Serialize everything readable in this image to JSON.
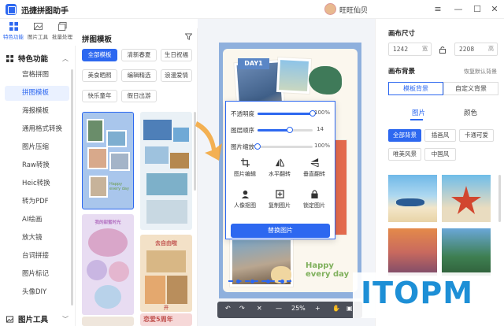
{
  "app": {
    "title": "迅捷拼图助手",
    "user_name": "旺旺仙贝"
  },
  "rail": [
    {
      "label": "特色功能",
      "icon": "grid-icon",
      "active": true
    },
    {
      "label": "图片工具",
      "icon": "image-tool-icon",
      "active": false
    },
    {
      "label": "批量处理",
      "icon": "batch-icon",
      "active": false
    }
  ],
  "nav": {
    "section_features": "特色功能",
    "items": [
      "宫格拼图",
      "拼图模板",
      "海报模板",
      "通用格式转换",
      "图片压缩",
      "Raw转换",
      "Heic转换",
      "转为PDF",
      "AI绘画",
      "放大镜",
      "台词拼接",
      "图片标记",
      "头像DIY"
    ],
    "active_index": 1,
    "section_image_tools": "图片工具"
  },
  "template_panel": {
    "title": "拼图模板",
    "tags": [
      "全部模板",
      "清新春夏",
      "生日祝福",
      "美食晒照",
      "编辑精选",
      "浪漫爱情",
      "快乐童年",
      "假日出游"
    ],
    "active_tag_index": 0,
    "thumb_text": {
      "t3_line1": "我的甜蜜时光",
      "t4_line1": "去自由啦",
      "t4_line2": "开",
      "t5_title": "恋爱5周年",
      "t1_caption": "Happy every day"
    }
  },
  "poster": {
    "day_tag": "DAY1",
    "happy_line1": "Happy",
    "happy_line2": "every day"
  },
  "popup": {
    "opacity_label": "不透明度",
    "opacity_value": "100%",
    "opacity_fraction": 1.0,
    "layer_label": "图层顺序",
    "layer_value": "14",
    "layer_fraction": 0.58,
    "zoom_label": "图片缩放",
    "zoom_value": "100%",
    "zoom_fraction": 0.0,
    "tools": [
      "图片编辑",
      "水平翻转",
      "垂直翻转",
      "人像抠图",
      "复制图片",
      "锁定图片"
    ],
    "replace_button": "替换图片"
  },
  "bottom_bar": {
    "zoom": "25%"
  },
  "right_panel": {
    "canvas_size_title": "画布尺寸",
    "width_value": "1242",
    "width_unit": "宽",
    "height_value": "2208",
    "height_unit": "高",
    "background_title": "画布背景",
    "restore_link": "恢复默认背景",
    "seg_template": "模板背景",
    "seg_custom": "自定义背景",
    "subtab_image": "图片",
    "subtab_color": "颜色",
    "bg_tags": [
      "全部背景",
      "插画风",
      "卡通可爱",
      "唯美风景",
      "中国风"
    ],
    "bg_tag_active_index": 0
  },
  "watermark": "ITOPM",
  "colors": {
    "accent": "#2d68f0",
    "watermark": "#1d8fd6"
  }
}
